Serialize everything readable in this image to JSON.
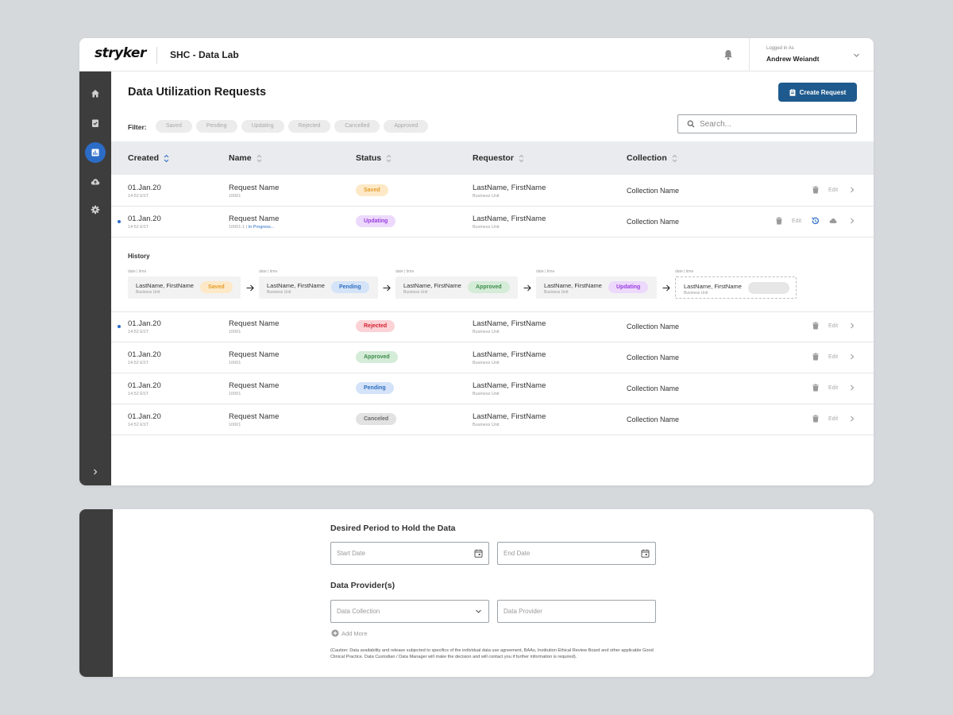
{
  "app": {
    "logo": "stryker",
    "title": "SHC - Data Lab"
  },
  "user": {
    "logged_label": "Logged in As",
    "name": "Andrew Weiandt"
  },
  "sidebar": {
    "items": [
      {
        "icon": "home-icon"
      },
      {
        "icon": "clipboard-check-icon"
      },
      {
        "icon": "chart-icon",
        "active": true
      },
      {
        "icon": "cloud-upload-icon"
      },
      {
        "icon": "gear-icon"
      }
    ]
  },
  "page": {
    "title": "Data Utilization Requests",
    "create_label": "Create Request"
  },
  "filter": {
    "label": "Filter:",
    "chips": [
      "Saved",
      "Pending",
      "Updating",
      "Rejected",
      "Cancelled",
      "Approved"
    ]
  },
  "search": {
    "placeholder": "Search..."
  },
  "table": {
    "headers": [
      "Created",
      "Name",
      "Status",
      "Requestor",
      "Collection"
    ],
    "rows": [
      {
        "date": "01.Jan.20",
        "time": "14:52 EST",
        "name": "Request Name",
        "id": "10001",
        "id_extra": "",
        "status": "Saved",
        "requestor": "LastName, FirstName",
        "unit": "Business Unit",
        "collection": "Collection Name",
        "edit": "Edit",
        "dot": false
      },
      {
        "date": "01.Jan.20",
        "time": "14:52 EST",
        "name": "Request Name",
        "id": "10001-1  |  ",
        "id_extra": "In Progress...",
        "status": "Updating",
        "requestor": "LastName, FirstName",
        "unit": "Business Unit",
        "collection": "Collection Name",
        "edit": "Edit",
        "dot": true
      },
      {
        "date": "01.Jan.20",
        "time": "14:52 EST",
        "name": "Request Name",
        "id": "10001",
        "id_extra": "",
        "status": "Rejected",
        "requestor": "LastName, FirstName",
        "unit": "Business Unit",
        "collection": "Collection Name",
        "edit": "Edit",
        "dot": true
      },
      {
        "date": "01.Jan.20",
        "time": "14:52 EST",
        "name": "Request Name",
        "id": "10001",
        "id_extra": "",
        "status": "Approved",
        "requestor": "LastName, FirstName",
        "unit": "Business Unit",
        "collection": "Collection Name",
        "edit": "Edit",
        "dot": false
      },
      {
        "date": "01.Jan.20",
        "time": "14:52 EST",
        "name": "Request Name",
        "id": "10001",
        "id_extra": "",
        "status": "Pending",
        "requestor": "LastName, FirstName",
        "unit": "Business Unit",
        "collection": "Collection Name",
        "edit": "Edit",
        "dot": false
      },
      {
        "date": "01.Jan.20",
        "time": "14:52 EST",
        "name": "Request Name",
        "id": "10001",
        "id_extra": "",
        "status": "Canceled",
        "requestor": "LastName, FirstName",
        "unit": "Business Unit",
        "collection": "Collection Name",
        "edit": "Edit",
        "dot": false
      }
    ]
  },
  "history": {
    "title": "History",
    "meta": "date  |  time",
    "steps": [
      {
        "name": "LastName, FirstName",
        "unit": "Business Unit",
        "status": "Saved"
      },
      {
        "name": "LastName, FirstName",
        "unit": "Business Unit",
        "status": "Pending"
      },
      {
        "name": "LastName, FirstName",
        "unit": "Business Unit",
        "status": "Approved"
      },
      {
        "name": "LastName, FirstName",
        "unit": "Business Unit",
        "status": "Updating"
      },
      {
        "name": "LastName, FirstName",
        "unit": "Business Unit",
        "status": ""
      }
    ]
  },
  "form": {
    "period_title": "Desired Period to Hold the Data",
    "start_placeholder": "Start Date",
    "end_placeholder": "End Date",
    "provider_title": "Data Provider(s)",
    "collection_placeholder": "Data Collection",
    "provider_placeholder": "Data Provider",
    "add_more": "Add More",
    "caution": "(Caution: Data availability and release subjected to specifics of the individual data use agreement, BAAs, Institution Ethical Review Board and other applicable Good Clinical Practice. Data Custodian / Data Manager will make the decision and will contact you if further information is required)."
  },
  "status_colors": {
    "Saved": "#e49e2d",
    "Updating": "#9b3ce0",
    "Rejected": "#d4212f",
    "Approved": "#3c8c4a",
    "Pending": "#2e6ec2",
    "Canceled": "#6b6b6b"
  }
}
